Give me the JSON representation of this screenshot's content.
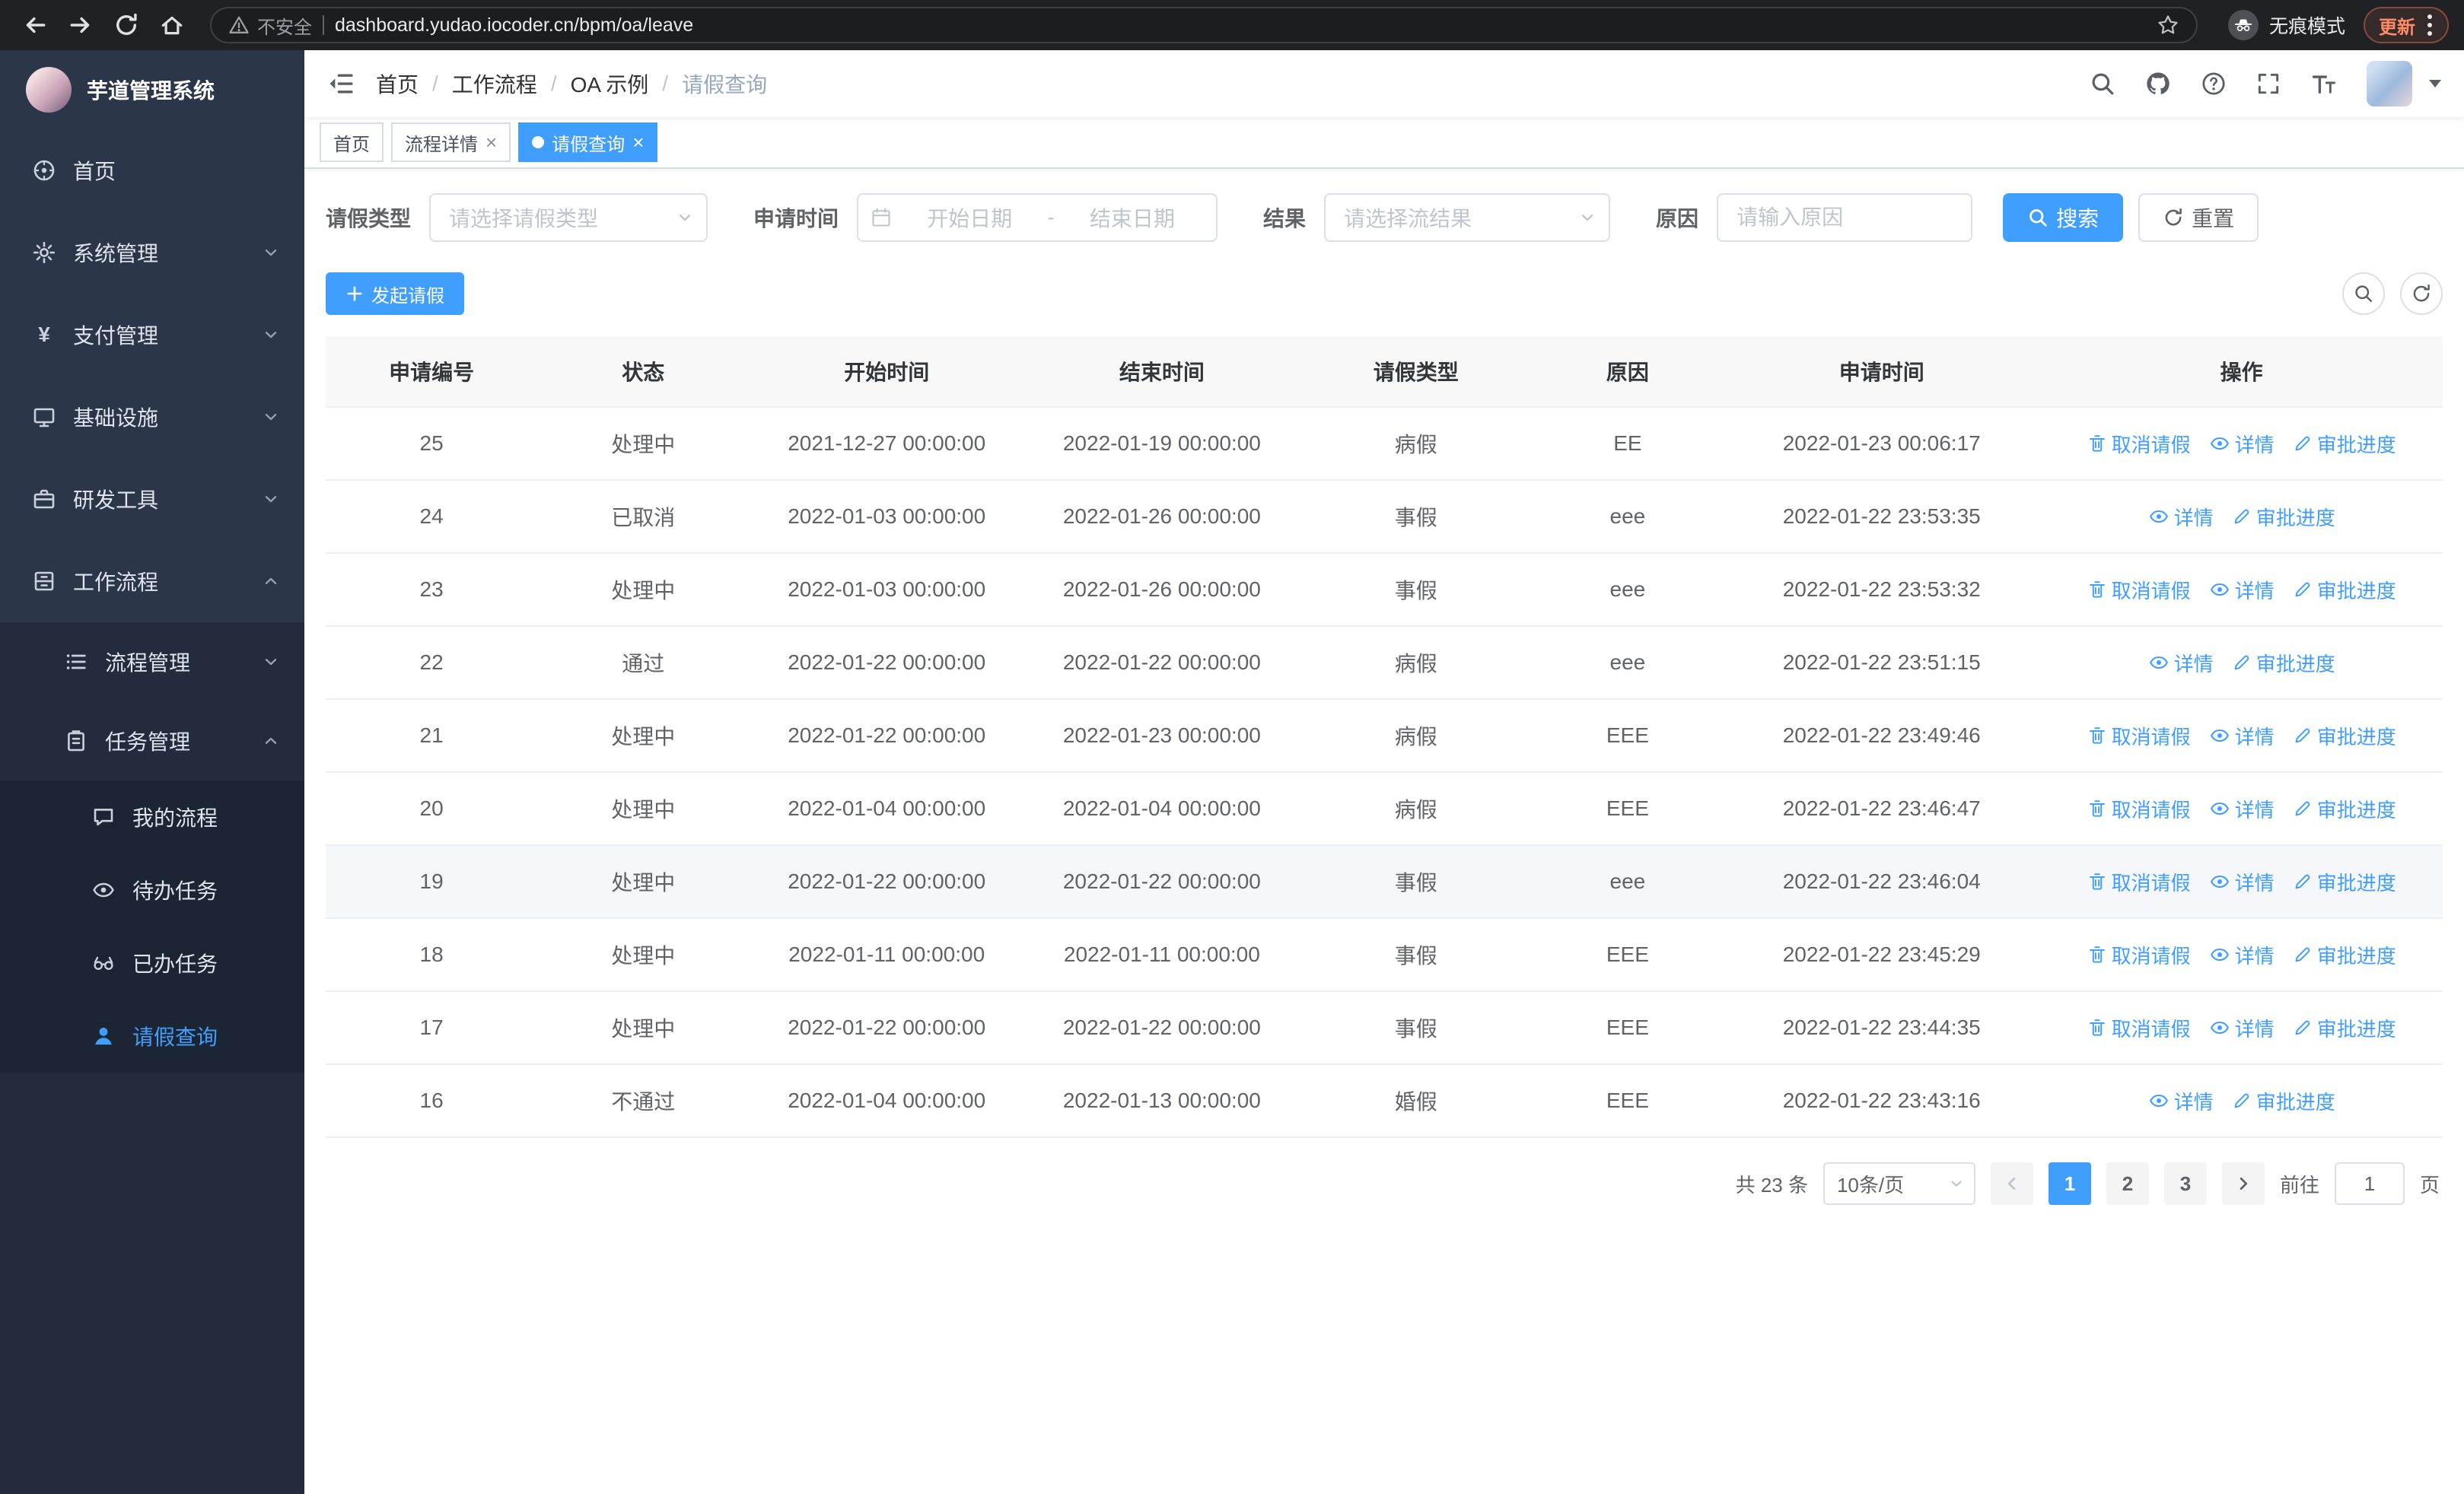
{
  "browser": {
    "security_warning": "不安全",
    "url": "dashboard.yudao.iocoder.cn/bpm/oa/leave",
    "incognito_label": "无痕模式",
    "update_label": "更新"
  },
  "sidebar": {
    "app_title": "芋道管理系统",
    "items": [
      {
        "label": "首页"
      },
      {
        "label": "系统管理"
      },
      {
        "label": "支付管理"
      },
      {
        "label": "基础设施"
      },
      {
        "label": "研发工具"
      },
      {
        "label": "工作流程"
      }
    ],
    "workflow_children": [
      {
        "label": "流程管理"
      },
      {
        "label": "任务管理"
      }
    ],
    "task_children": [
      {
        "label": "我的流程"
      },
      {
        "label": "待办任务"
      },
      {
        "label": "已办任务"
      },
      {
        "label": "请假查询"
      }
    ]
  },
  "header": {
    "breadcrumb": [
      "首页",
      "工作流程",
      "OA 示例",
      "请假查询"
    ]
  },
  "tabs": [
    {
      "label": "首页"
    },
    {
      "label": "流程详情"
    },
    {
      "label": "请假查询"
    }
  ],
  "filters": {
    "leave_type_label": "请假类型",
    "leave_type_placeholder": "请选择请假类型",
    "apply_time_label": "申请时间",
    "start_date_placeholder": "开始日期",
    "date_separator": "-",
    "end_date_placeholder": "结束日期",
    "result_label": "结果",
    "result_placeholder": "请选择流结果",
    "reason_label": "原因",
    "reason_placeholder": "请输入原因",
    "search_button": "搜索",
    "reset_button": "重置"
  },
  "toolbar": {
    "create_button": "发起请假"
  },
  "table": {
    "columns": [
      "申请编号",
      "状态",
      "开始时间",
      "结束时间",
      "请假类型",
      "原因",
      "申请时间",
      "操作"
    ],
    "actions": {
      "cancel": "取消请假",
      "detail": "详情",
      "progress": "审批进度"
    },
    "rows": [
      {
        "id": "25",
        "status": "处理中",
        "start": "2021-12-27 00:00:00",
        "end": "2022-01-19 00:00:00",
        "type": "病假",
        "reason": "EE",
        "applied": "2022-01-23 00:06:17",
        "cancelable": true,
        "highlighted": false
      },
      {
        "id": "24",
        "status": "已取消",
        "start": "2022-01-03 00:00:00",
        "end": "2022-01-26 00:00:00",
        "type": "事假",
        "reason": "eee",
        "applied": "2022-01-22 23:53:35",
        "cancelable": false,
        "highlighted": false
      },
      {
        "id": "23",
        "status": "处理中",
        "start": "2022-01-03 00:00:00",
        "end": "2022-01-26 00:00:00",
        "type": "事假",
        "reason": "eee",
        "applied": "2022-01-22 23:53:32",
        "cancelable": true,
        "highlighted": false
      },
      {
        "id": "22",
        "status": "通过",
        "start": "2022-01-22 00:00:00",
        "end": "2022-01-22 00:00:00",
        "type": "病假",
        "reason": "eee",
        "applied": "2022-01-22 23:51:15",
        "cancelable": false,
        "highlighted": false
      },
      {
        "id": "21",
        "status": "处理中",
        "start": "2022-01-22 00:00:00",
        "end": "2022-01-23 00:00:00",
        "type": "病假",
        "reason": "EEE",
        "applied": "2022-01-22 23:49:46",
        "cancelable": true,
        "highlighted": false
      },
      {
        "id": "20",
        "status": "处理中",
        "start": "2022-01-04 00:00:00",
        "end": "2022-01-04 00:00:00",
        "type": "病假",
        "reason": "EEE",
        "applied": "2022-01-22 23:46:47",
        "cancelable": true,
        "highlighted": false
      },
      {
        "id": "19",
        "status": "处理中",
        "start": "2022-01-22 00:00:00",
        "end": "2022-01-22 00:00:00",
        "type": "事假",
        "reason": "eee",
        "applied": "2022-01-22 23:46:04",
        "cancelable": true,
        "highlighted": true
      },
      {
        "id": "18",
        "status": "处理中",
        "start": "2022-01-11 00:00:00",
        "end": "2022-01-11 00:00:00",
        "type": "事假",
        "reason": "EEE",
        "applied": "2022-01-22 23:45:29",
        "cancelable": true,
        "highlighted": false
      },
      {
        "id": "17",
        "status": "处理中",
        "start": "2022-01-22 00:00:00",
        "end": "2022-01-22 00:00:00",
        "type": "事假",
        "reason": "EEE",
        "applied": "2022-01-22 23:44:35",
        "cancelable": true,
        "highlighted": false
      },
      {
        "id": "16",
        "status": "不通过",
        "start": "2022-01-04 00:00:00",
        "end": "2022-01-13 00:00:00",
        "type": "婚假",
        "reason": "EEE",
        "applied": "2022-01-22 23:43:16",
        "cancelable": false,
        "highlighted": false
      }
    ]
  },
  "pagination": {
    "total": "共 23 条",
    "page_size": "10条/页",
    "pages": [
      "1",
      "2",
      "3"
    ],
    "active_page": "1",
    "goto_label": "前往",
    "goto_value": "1",
    "goto_suffix": "页"
  },
  "colors": {
    "accent": "#409eff",
    "sidebar_bg": "#2b3648",
    "sidebar_submenu_bg": "#222c3c",
    "chrome_bg": "#202124",
    "update_badge_text": "#ff8a65",
    "row_highlight": "#f5f7fa"
  }
}
